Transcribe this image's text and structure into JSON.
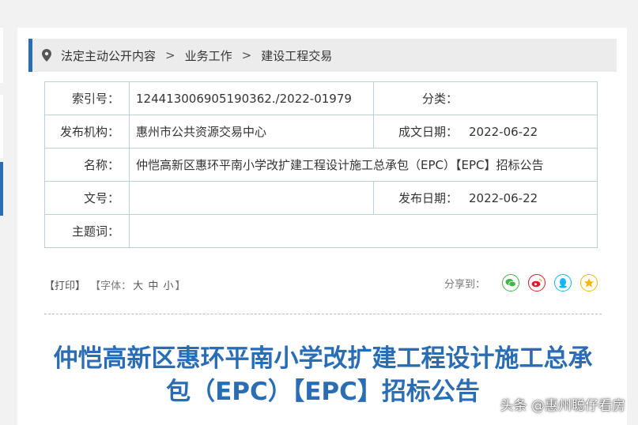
{
  "breadcrumb": {
    "items": [
      "法定主动公开内容",
      "业务工作",
      "建设工程交易"
    ],
    "separator": ">"
  },
  "info": {
    "index_label": "索引号：",
    "index_value": "124413006905190362./2022-01979",
    "category_label": "分类：",
    "category_value": "",
    "publisher_label": "发布机构：",
    "publisher_value": "惠州市公共资源交易中心",
    "created_label": "成文日期：",
    "created_value": "2022-06-22",
    "name_label": "名称：",
    "name_value": "仲恺高新区惠环平南小学改扩建工程设计施工总承包（EPC）【EPC】招标公告",
    "docno_label": "文号：",
    "docno_value": "",
    "published_label": "发布日期：",
    "published_value": "2022-06-22",
    "subject_label": "主题词：",
    "subject_value": ""
  },
  "tools": {
    "print": "【打印】",
    "font_prefix": "【字体：",
    "font_large": "大",
    "font_medium": "中",
    "font_small": "小",
    "font_suffix": "】",
    "share_label": "分享到："
  },
  "share_icons": [
    {
      "name": "wechat-icon",
      "color": "#44b549"
    },
    {
      "name": "weibo-icon",
      "color": "#e6162d"
    },
    {
      "name": "qq-icon",
      "color": "#12b7f5"
    },
    {
      "name": "qzone-icon",
      "color": "#f5b800"
    }
  ],
  "article": {
    "title_line1": "仲恺高新区惠环平南小学改扩建工程设计施工总承",
    "title_line2": "包（EPC）【EPC】招标公告"
  },
  "watermark": "头条 @惠州聪仔看房",
  "colors": {
    "accent": "#2a6db5",
    "border": "#b9cfe3"
  }
}
